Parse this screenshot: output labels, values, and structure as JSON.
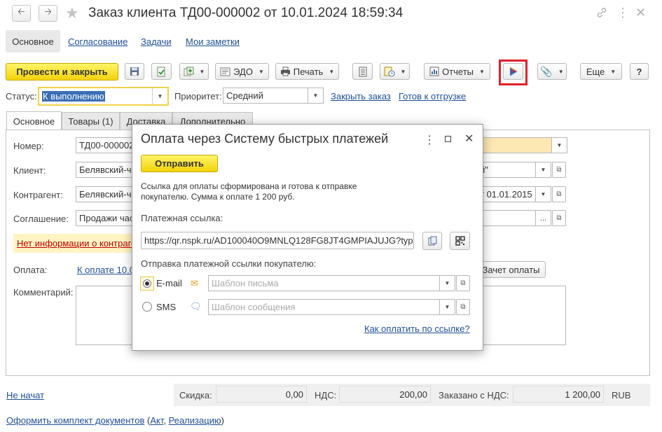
{
  "window": {
    "title": "Заказ клиента ТД00-000002 от 10.01.2024 18:59:34"
  },
  "section_tabs": [
    "Основное",
    "Согласование",
    "Задачи",
    "Мои заметки"
  ],
  "toolbar": {
    "post_close": "Провести и закрыть",
    "edo": "ЭДО",
    "print": "Печать",
    "reports": "Отчеты",
    "more": "Еще",
    "help": "?"
  },
  "status_row": {
    "status_label": "Статус:",
    "status_value": "К выполнению",
    "priority_label": "Приоритет:",
    "priority_value": "Средний",
    "close_order": "Закрыть заказ",
    "ready_to_ship": "Готов к отгрузке"
  },
  "form_tabs": [
    "Основное",
    "Товары (1)",
    "Доставка",
    "Дополнительно"
  ],
  "form": {
    "number_label": "Номер:",
    "number_value": "ТД00-000002",
    "client_label": "Клиент:",
    "client_value": "Белявский-ч",
    "client_right": "й\"",
    "contractor_label": "Контрагент:",
    "contractor_value": "Белявский-ч",
    "contractor_right": "т 01.01.2015",
    "agreement_label": "Соглашение:",
    "agreement_value": "Продажи час",
    "agreement_btn": "...",
    "warning": "Нет информации о контраге",
    "payment_label": "Оплата:",
    "payment_link": "К оплате 10.0",
    "offset_btn": "Зачет оплаты",
    "comment_label": "Комментарий:"
  },
  "footer": {
    "status_link": "Не начат",
    "discount_label": "Скидка:",
    "discount_value": "0,00",
    "vat_label": "НДС:",
    "vat_value": "200,00",
    "ordered_label": "Заказано с НДС:",
    "ordered_value": "1 200,00",
    "currency": "RUB",
    "docs_link": "Оформить комплект документов",
    "docs_paren_open": "(",
    "docs_act": "Акт",
    "docs_sep": ",",
    "docs_realization": "Реализацию",
    "docs_paren_close": ")"
  },
  "dialog": {
    "title": "Оплата через Систему быстрых платежей",
    "send": "Отправить",
    "info": "Ссылка для оплаты сформирована и готова к отправке покупателю. Сумма к оплате 1 200 руб.",
    "link_label": "Платежная ссылка:",
    "link_value": "https://qr.nspk.ru/AD100040O9MNLQ128FG8JT4GMPIAJUJG?typ",
    "send_label": "Отправка платежной ссылки покупателю:",
    "email_label": "E-mail",
    "email_placeholder": "Шаблон письма",
    "sms_label": "SMS",
    "sms_placeholder": "Шаблон сообщения",
    "how_link": "Как оплатить по ссылке?"
  },
  "colors": {
    "accent_yellow": "#f3d20b",
    "link_blue": "#1f4f9a",
    "highlight_red": "#e0202a",
    "warning_red": "#c00000"
  }
}
